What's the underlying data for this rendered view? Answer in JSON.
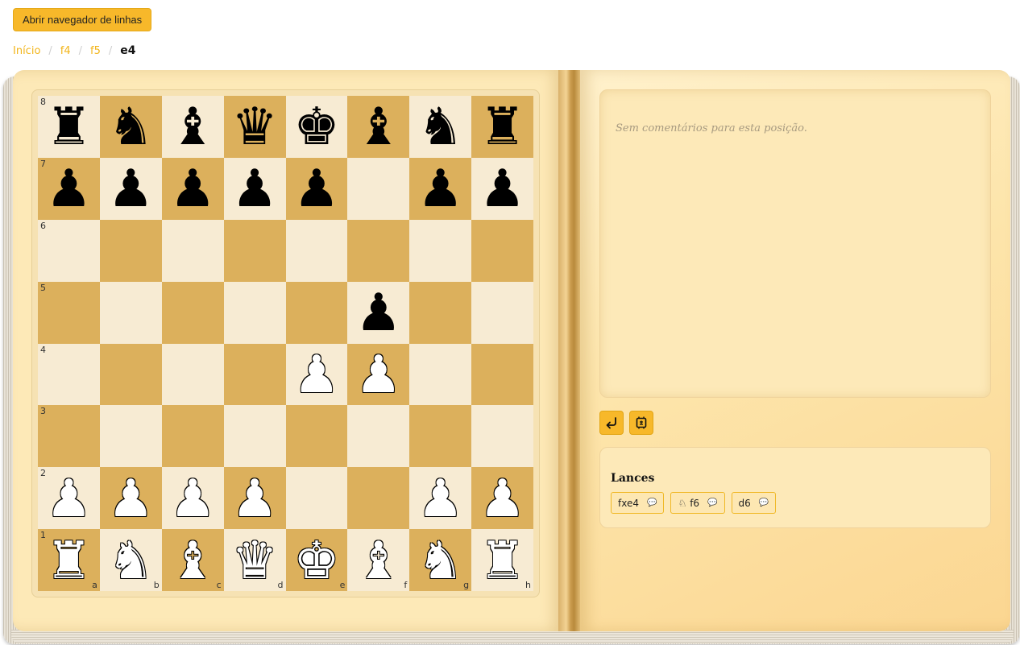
{
  "header": {
    "open_navigator_label": "Abrir navegador de linhas"
  },
  "breadcrumb": {
    "items": [
      "Início",
      "f4",
      "f5"
    ],
    "current": "e4"
  },
  "board": {
    "files": [
      "a",
      "b",
      "c",
      "d",
      "e",
      "f",
      "g",
      "h"
    ],
    "ranks": [
      "8",
      "7",
      "6",
      "5",
      "4",
      "3",
      "2",
      "1"
    ],
    "position": [
      [
        "br",
        "bn",
        "bb",
        "bq",
        "bk",
        "bb",
        "bn",
        "br"
      ],
      [
        "bp",
        "bp",
        "bp",
        "bp",
        "bp",
        "",
        "bp",
        "bp"
      ],
      [
        "",
        "",
        "",
        "",
        "",
        "",
        "",
        ""
      ],
      [
        "",
        "",
        "",
        "",
        "",
        "bp",
        "",
        ""
      ],
      [
        "",
        "",
        "",
        "",
        "wp",
        "wp",
        "",
        ""
      ],
      [
        "",
        "",
        "",
        "",
        "",
        "",
        "",
        ""
      ],
      [
        "wp",
        "wp",
        "wp",
        "wp",
        "",
        "",
        "wp",
        "wp"
      ],
      [
        "wr",
        "wn",
        "wb",
        "wq",
        "wk",
        "wb",
        "wn",
        "wr"
      ]
    ],
    "colors": {
      "light": "#f7ebd3",
      "dark": "#dcb05c"
    }
  },
  "comments": {
    "text": "Sem comentários para esta posição."
  },
  "tools": {
    "back_icon": "return-arrow-icon",
    "flip_icon": "flip-board-icon"
  },
  "moves": {
    "title": "Lances",
    "items": [
      {
        "piece_icon": "",
        "san": "fxe4",
        "icon": "comment-icon"
      },
      {
        "piece_icon": "♘",
        "san": "f6",
        "icon": "comment-icon"
      },
      {
        "piece_icon": "",
        "san": "d6",
        "icon": "comment-icon"
      }
    ]
  },
  "accent_color": "#f7b82a"
}
